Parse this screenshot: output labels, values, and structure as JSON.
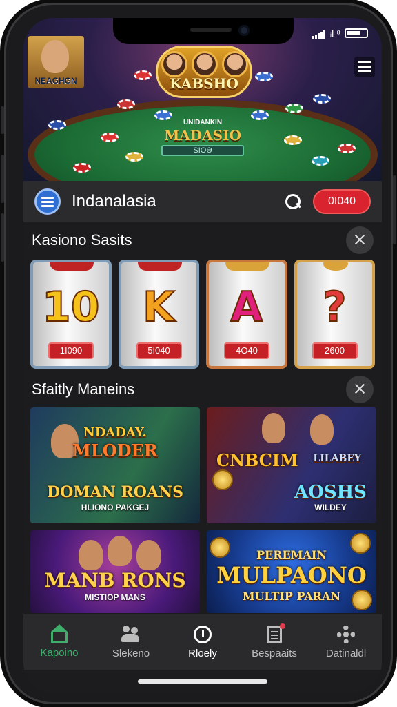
{
  "status_bar": {
    "signal_text": "ᵢl ⁸"
  },
  "hero": {
    "logo_text": "KABSHO",
    "title_top": "UNIDANKIN",
    "title": "MADASIO",
    "plate": "SIOƏ",
    "avatar_name": "NEAGHGN"
  },
  "app_bar": {
    "title": "Indanalasia",
    "balance": "0I040"
  },
  "section1": {
    "title": "Kasiono Sasits"
  },
  "slots": [
    {
      "symbol": "10",
      "price": "1I090",
      "color": "#f4c21a"
    },
    {
      "symbol": "K",
      "price": "5I040",
      "color": "#f2a21e"
    },
    {
      "symbol": "A",
      "price": "4O40",
      "color": "#e0207a"
    },
    {
      "symbol": "?",
      "price": "2600",
      "color": "#e23b3b"
    }
  ],
  "section2": {
    "title": "Sfaitly Maneins"
  },
  "games": [
    {
      "title_top": "NDADAY.",
      "title_mid": "MLODER",
      "title": "DOMAN ROANS",
      "subtitle": "HLIONO PAKGEJ"
    },
    {
      "title_top": "CNBCIM",
      "title_mid": "LILABEY",
      "title": "AOSHS",
      "subtitle": "WILDEY"
    },
    {
      "title": "MANB RONS",
      "subtitle": "MISTIOP MANS"
    },
    {
      "title_top": "PEREMAIN",
      "title": "MULPAONO",
      "subtitle": "MULTIP PARAN"
    }
  ],
  "nav": [
    {
      "label": "Kapoino",
      "icon": "home-icon",
      "active": true
    },
    {
      "label": "Slekeno",
      "icon": "users-icon",
      "active": false
    },
    {
      "label": "Rloely",
      "icon": "clock-icon",
      "active": false
    },
    {
      "label": "Bespaaits",
      "icon": "document-icon",
      "active": false
    },
    {
      "label": "Datinaldl",
      "icon": "gear-icon",
      "active": false
    }
  ],
  "colors": {
    "accent_green": "#3fae6b",
    "balance_red": "#d9232e",
    "app_bar": "#2b2b2e"
  }
}
